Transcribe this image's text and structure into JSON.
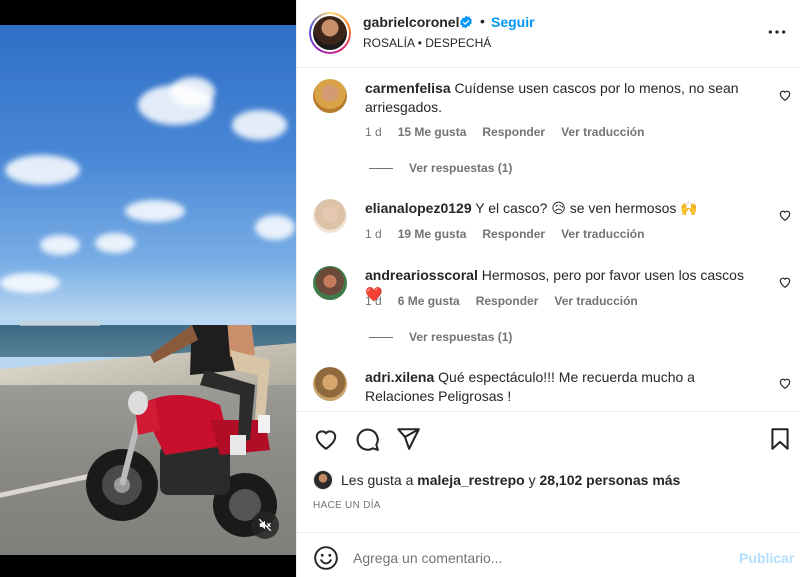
{
  "header": {
    "username": "gabrielcoronel",
    "separator": "•",
    "follow_label": "Seguir",
    "music": "ROSALÍA • DESPECHÁ"
  },
  "comments": [
    {
      "user": "carmenfelisa",
      "text": "Cuídense usen cascos por lo menos, no sean arriesgados.",
      "age": "1 d",
      "likes": "15 Me gusta",
      "reply": "Responder",
      "translate": "Ver traducción",
      "view_replies": "Ver respuestas (1)"
    },
    {
      "user": "elianalopez0129",
      "text": "Y el casco? 😥 se ven hermosos 🙌",
      "age": "1 d",
      "likes": "19 Me gusta",
      "reply": "Responder",
      "translate": "Ver traducción"
    },
    {
      "user": "andreariosscoral",
      "text": "Hermosos, pero por favor usen los cascos ❤️",
      "age": "1 d",
      "likes": "6 Me gusta",
      "reply": "Responder",
      "translate": "Ver traducción",
      "view_replies": "Ver respuestas (1)"
    },
    {
      "user": "adri.xilena",
      "text": "Qué espectáculo!!! Me recuerda mucho a Relaciones Peligrosas !"
    }
  ],
  "likes": {
    "prefix": "Les gusta a",
    "user": "maleja_restrepo",
    "connector": "y",
    "count": "28,102 personas más"
  },
  "date": "HACE UN DÍA",
  "add_comment": {
    "placeholder": "Agrega un comentario...",
    "post_label": "Publicar"
  },
  "colors": {
    "accent": "#0095f6",
    "post_disabled": "#b2dffc",
    "secondary_text": "#737373"
  }
}
